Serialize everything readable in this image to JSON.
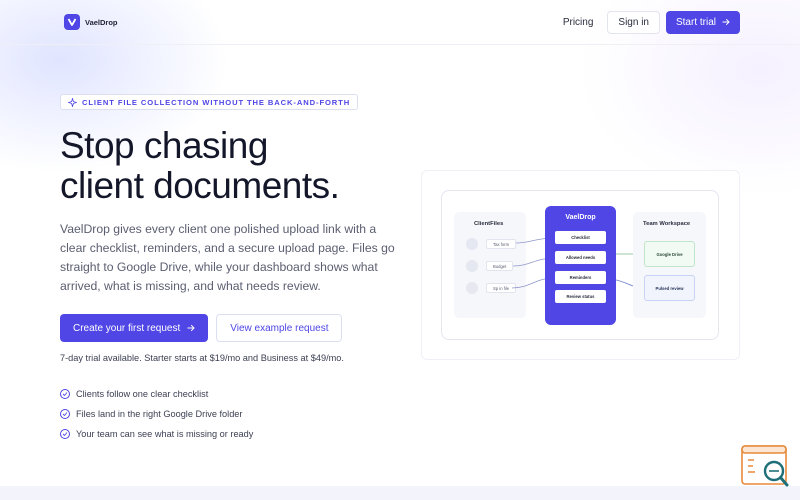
{
  "brand": {
    "name": "VaelDrop"
  },
  "nav": {
    "pricing": "Pricing",
    "sign_in": "Sign in",
    "start_trial": "Start trial"
  },
  "hero": {
    "eyebrow": "CLIENT FILE COLLECTION WITHOUT THE BACK-AND-FORTH",
    "headline_line1": "Stop chasing",
    "headline_line2": "client documents.",
    "lede": "VaelDrop gives every client one polished upload link with a clear checklist, reminders, and a secure upload page. Files go straight to Google Drive, while your dashboard shows what arrived, what is missing, and what needs review.",
    "cta_primary": "Create your first request",
    "cta_secondary": "View example request",
    "trial_note": "7-day trial available. Starter starts at $19/mo and Business at $49/mo.",
    "features": [
      "Clients follow one clear checklist",
      "Files land in the right Google Drive folder",
      "Your team can see what is missing or ready"
    ]
  },
  "illustration": {
    "left_title": "ClientFiles",
    "clients": [
      "Tax form",
      "Budget",
      "Sp in file"
    ],
    "hub_title": "VaelDrop",
    "hub_items": [
      "Checklist",
      "Allowed needs",
      "Reminders",
      "Review status"
    ],
    "right_title": "Team Workspace",
    "destinations": [
      "Google Drive",
      "Pulsed review"
    ]
  },
  "colors": {
    "accent": "#4f46e5",
    "text_dark": "#14172a",
    "text_muted": "#5a5e70"
  },
  "icons": {
    "sparkle": "sparkle-icon",
    "arrow": "arrow-right-icon",
    "check": "check-circle-icon",
    "help": "chat-search-icon"
  }
}
